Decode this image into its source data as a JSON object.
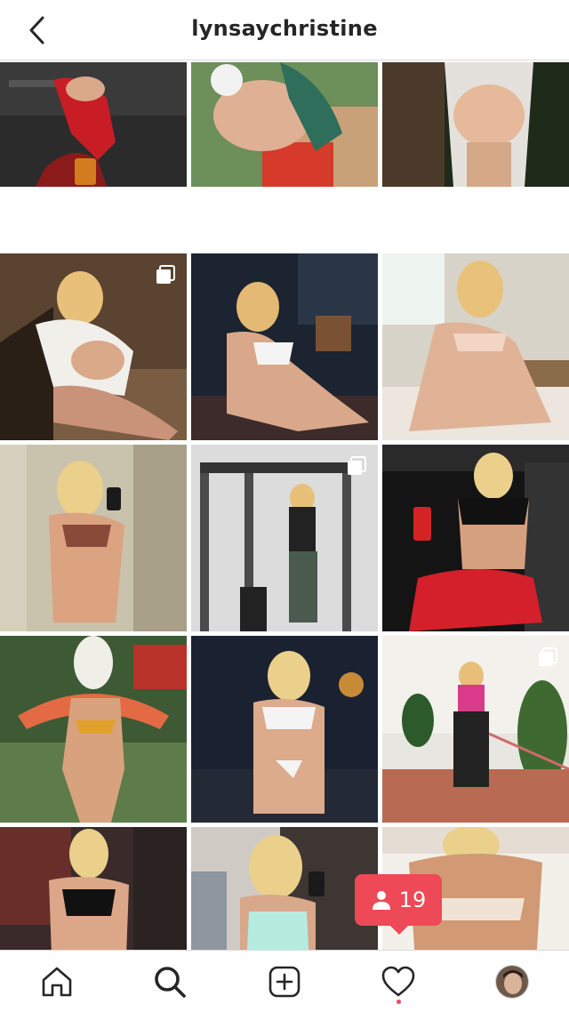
{
  "header": {
    "username": "lynsaychristine"
  },
  "notification": {
    "follower_count": "19",
    "icon": "person-icon"
  },
  "nav": {
    "items": [
      "home-icon",
      "search-icon",
      "new-post-icon",
      "activity-heart-icon",
      "profile-avatar"
    ]
  },
  "colors": {
    "accent": "#ed4956",
    "text": "#262626",
    "divider": "#dbdbdb"
  },
  "grid": {
    "posts": [
      {
        "multi": false
      },
      {
        "multi": false
      },
      {
        "multi": false
      },
      {
        "multi": true
      },
      {
        "multi": false
      },
      {
        "multi": false
      },
      {
        "multi": false
      },
      {
        "multi": true
      },
      {
        "multi": false
      },
      {
        "multi": false
      },
      {
        "multi": false
      },
      {
        "multi": true
      },
      {
        "multi": false
      },
      {
        "multi": false
      },
      {
        "multi": false
      }
    ]
  }
}
